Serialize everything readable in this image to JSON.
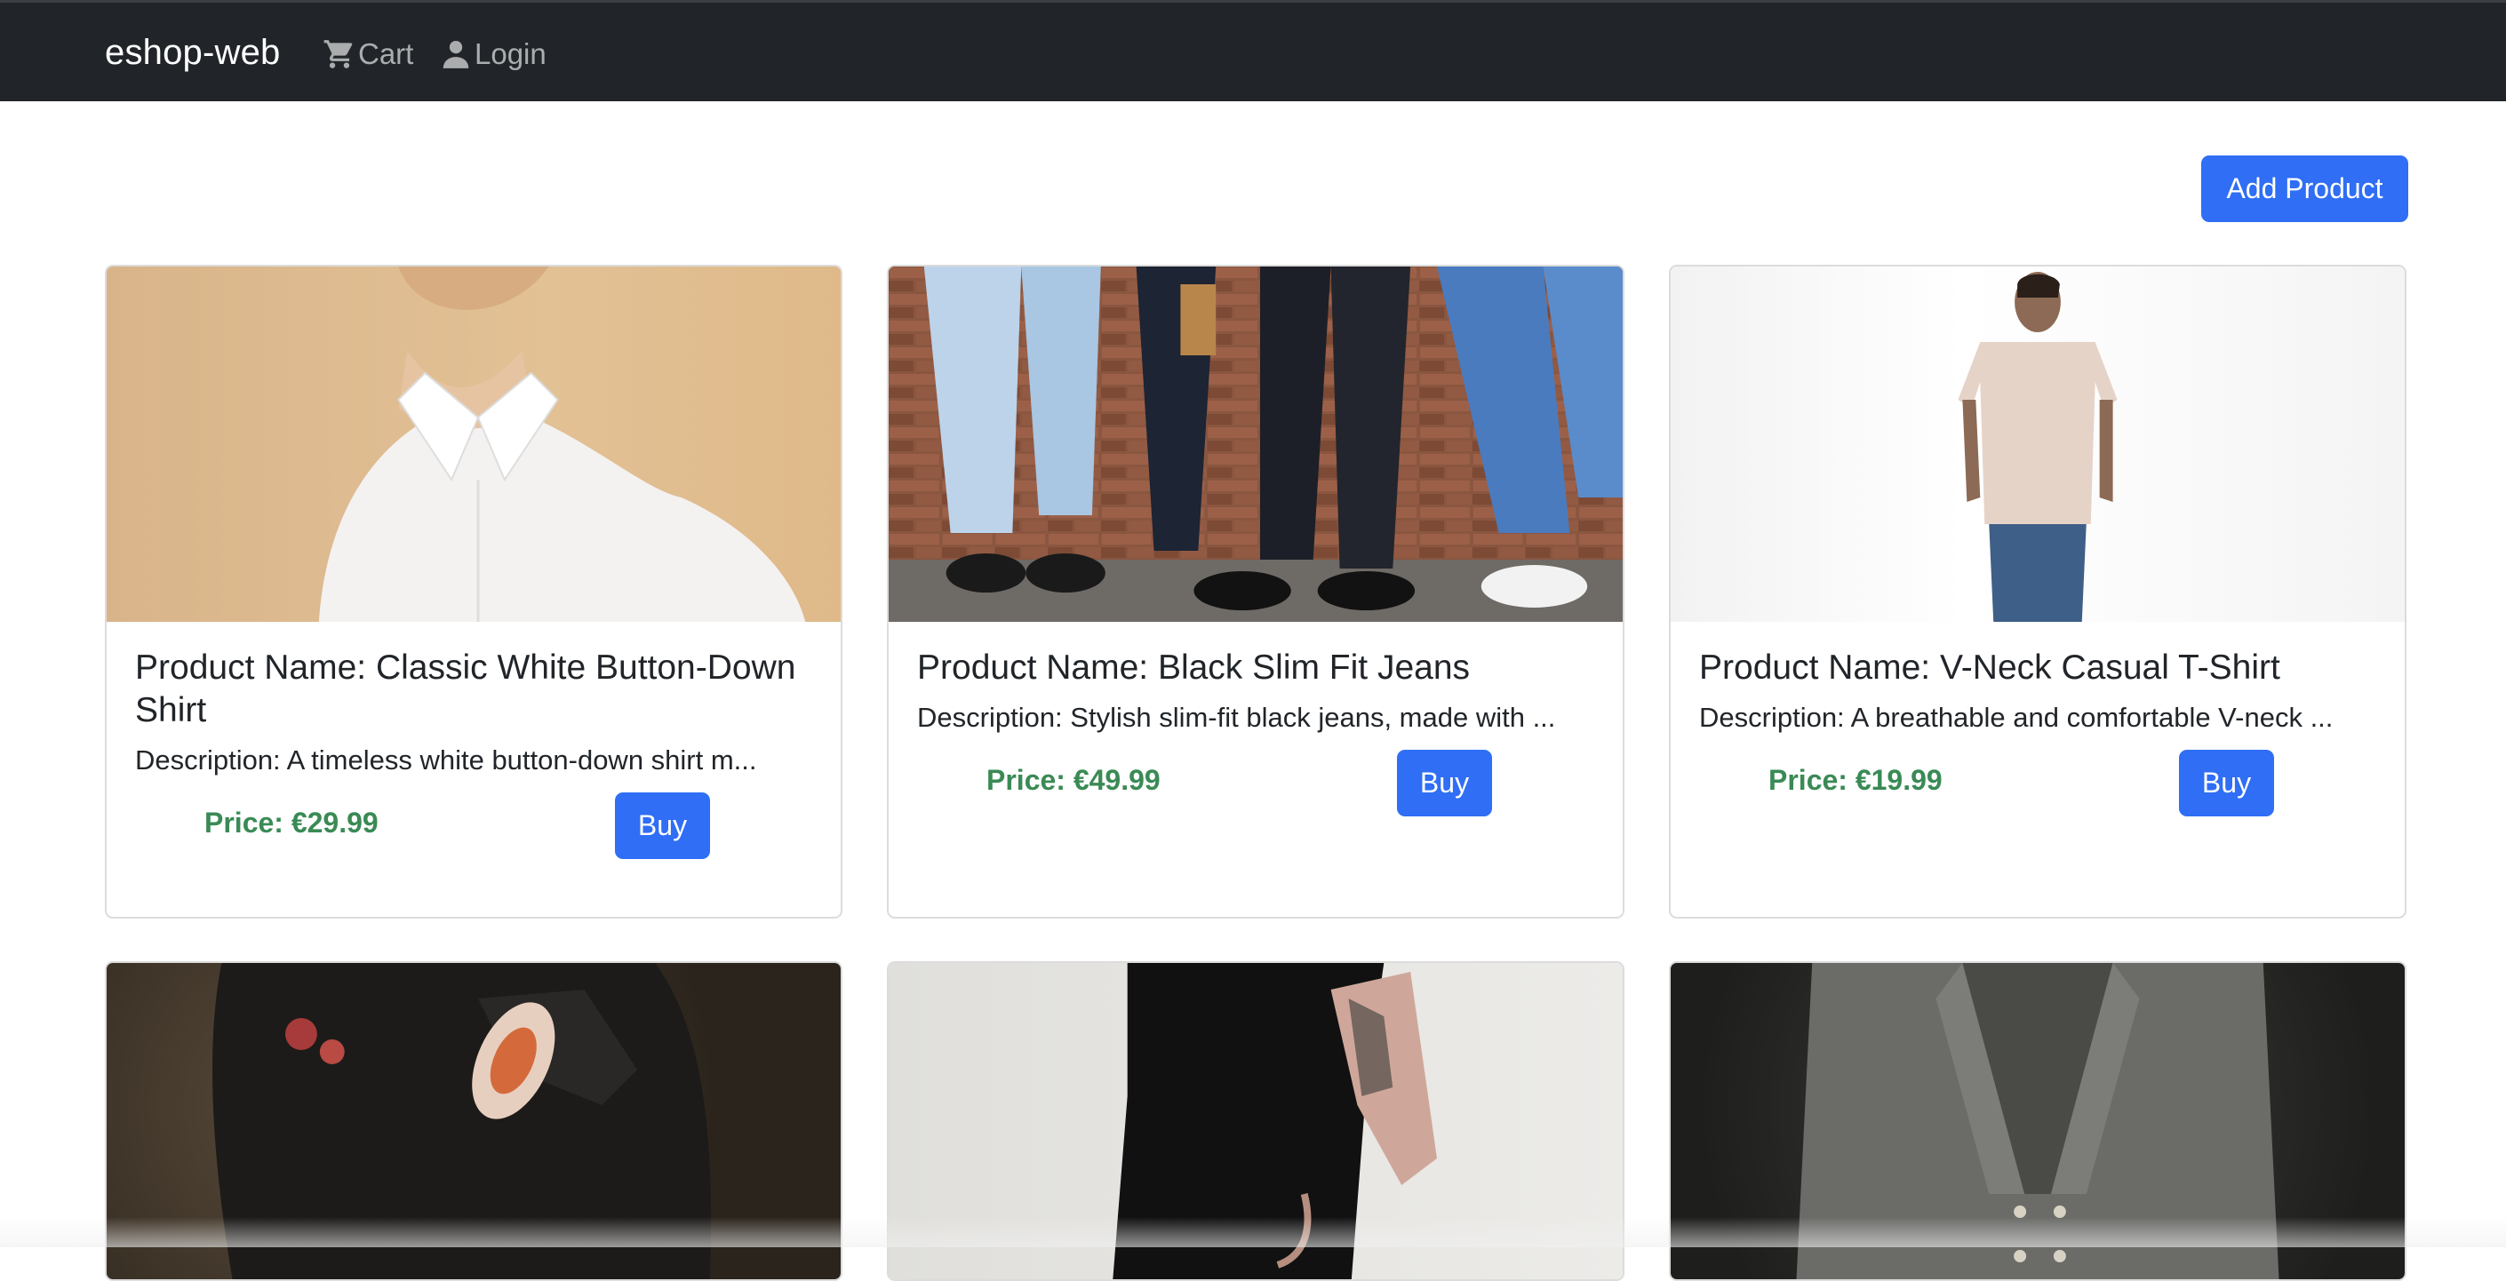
{
  "navbar": {
    "brand": "eshop-web",
    "cart_label": "Cart",
    "login_label": "Login",
    "cart_icon": "cart-icon",
    "login_icon": "user-icon",
    "background": "#212529"
  },
  "toolbar": {
    "add_product_label": "Add Product"
  },
  "colors": {
    "primary": "#2f6ef5",
    "price": "#3a8a55"
  },
  "products": [
    {
      "title": "Product Name: Classic White Button-Down Shirt",
      "description": "Description: A timeless white button-down shirt m...",
      "price": "Price: €29.99",
      "buy_label": "Buy"
    },
    {
      "title": "Product Name: Black Slim Fit Jeans",
      "description": "Description: Stylish slim-fit black jeans, made with ...",
      "price": "Price: €49.99",
      "buy_label": "Buy"
    },
    {
      "title": "Product Name: V-Neck Casual T-Shirt",
      "description": "Description: A breathable and comfortable V-neck ...",
      "price": "Price: €19.99",
      "buy_label": "Buy"
    },
    {
      "image": "product-image-leather-jacket"
    },
    {
      "image": "product-image-black-outfit"
    },
    {
      "image": "product-image-grey-blazer"
    }
  ]
}
